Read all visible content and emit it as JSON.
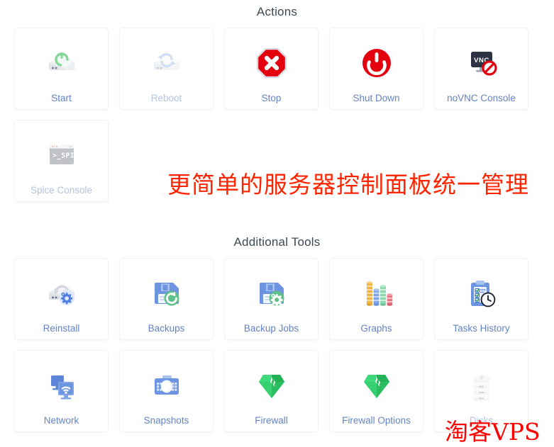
{
  "sections": [
    {
      "id": "actions",
      "title": "Actions",
      "items": [
        {
          "label": "Start",
          "icon": "hdd-power-green-icon",
          "disabled": false
        },
        {
          "label": "Reboot",
          "icon": "hdd-refresh-icon",
          "disabled": true
        },
        {
          "label": "Stop",
          "icon": "stop-octagon-icon",
          "disabled": false
        },
        {
          "label": "Shut Down",
          "icon": "power-circle-icon",
          "disabled": false
        },
        {
          "label": "noVNC Console",
          "icon": "vnc-blocked-icon",
          "disabled": false
        },
        {
          "label": "Spice Console",
          "icon": "spice-terminal-icon",
          "disabled": true
        }
      ]
    },
    {
      "id": "additional-tools",
      "title": "Additional Tools",
      "items": [
        {
          "label": "Reinstall",
          "icon": "hdd-gear-icon",
          "disabled": false
        },
        {
          "label": "Backups",
          "icon": "floppy-restore-icon",
          "disabled": false
        },
        {
          "label": "Backup Jobs",
          "icon": "floppy-gear-icon",
          "disabled": false
        },
        {
          "label": "Graphs",
          "icon": "bar-cylinders-icon",
          "disabled": false
        },
        {
          "label": "Tasks History",
          "icon": "clipboard-clock-icon",
          "disabled": false
        },
        {
          "label": "Network",
          "icon": "monitors-wifi-icon",
          "disabled": false
        },
        {
          "label": "Snapshots",
          "icon": "camera-icon",
          "disabled": false
        },
        {
          "label": "Firewall",
          "icon": "firewall-diamond-icon",
          "disabled": false
        },
        {
          "label": "Firewall Options",
          "icon": "firewall-diamond-icon",
          "disabled": false
        },
        {
          "label": "Disks",
          "icon": "disk-stack-icon",
          "disabled": true
        }
      ]
    }
  ],
  "watermarks": {
    "headline": "更简单的服务器控制面板统一管理",
    "headline_color": "#ff2400",
    "corner": "淘客VPS",
    "corner_color": "#ff0000"
  },
  "colors": {
    "label_link": "#6583c4",
    "label_disabled": "#b3c3e0",
    "section_title": "#3d4852",
    "card_border": "#f1f2f4",
    "accent_red": "#e3000f",
    "accent_green": "#36b37e",
    "accent_blue": "#6b8cd6"
  }
}
